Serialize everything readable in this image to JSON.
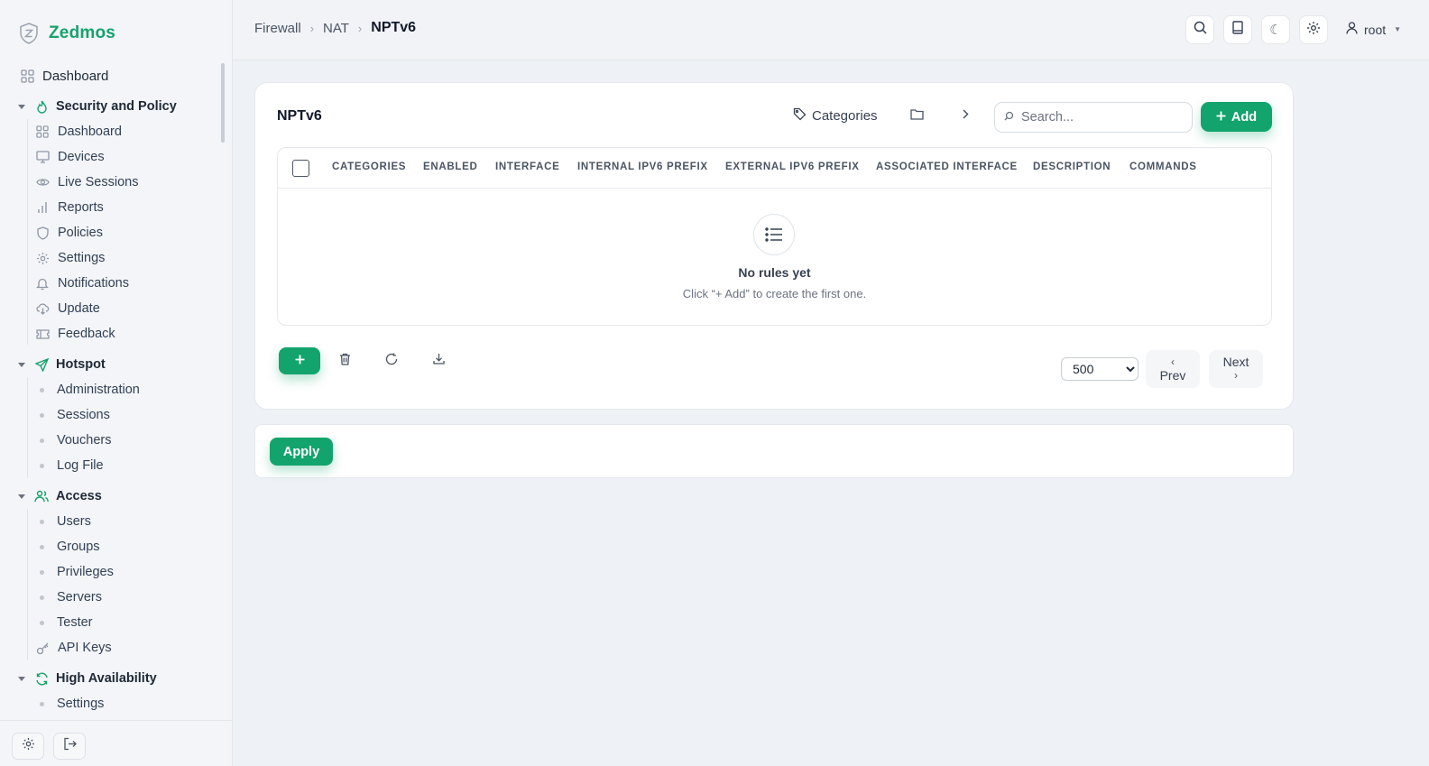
{
  "brand": {
    "name": "Zedmos",
    "logo_icon": "shield-z-icon",
    "accent": "#16a36b"
  },
  "sidebar": {
    "top_item": {
      "label": "Dashboard",
      "icon": "grid-icon"
    },
    "sections": [
      {
        "label": "Security and Policy",
        "icon": "flame-icon",
        "items": [
          {
            "label": "Dashboard",
            "icon": "grid-icon"
          },
          {
            "label": "Devices",
            "icon": "monitor-icon"
          },
          {
            "label": "Live Sessions",
            "icon": "eye-icon"
          },
          {
            "label": "Reports",
            "icon": "bar-chart-icon"
          },
          {
            "label": "Policies",
            "icon": "shield-icon"
          },
          {
            "label": "Settings",
            "icon": "gear-icon"
          },
          {
            "label": "Notifications",
            "icon": "bell-icon"
          },
          {
            "label": "Update",
            "icon": "cloud-download-icon"
          },
          {
            "label": "Feedback",
            "icon": "ticket-icon"
          }
        ]
      },
      {
        "label": "Hotspot",
        "icon": "send-icon",
        "items": [
          {
            "label": "Administration"
          },
          {
            "label": "Sessions"
          },
          {
            "label": "Vouchers"
          },
          {
            "label": "Log File"
          }
        ]
      },
      {
        "label": "Access",
        "icon": "users-icon",
        "items": [
          {
            "label": "Users"
          },
          {
            "label": "Groups"
          },
          {
            "label": "Privileges"
          },
          {
            "label": "Servers"
          },
          {
            "label": "Tester"
          },
          {
            "label": "API Keys",
            "icon": "key-icon"
          }
        ]
      },
      {
        "label": "High Availability",
        "icon": "refresh-icon",
        "items": [
          {
            "label": "Settings"
          }
        ]
      }
    ]
  },
  "breadcrumb": {
    "items": [
      "Firewall",
      "NAT"
    ],
    "current": "NPTv6"
  },
  "topbar": {
    "user": "root"
  },
  "card": {
    "title": "NPTv6",
    "categories_label": "Categories",
    "search_placeholder": "Search...",
    "add_label": "Add",
    "columns": [
      "CATEGORIES",
      "ENABLED",
      "INTERFACE",
      "INTERNAL IPV6 PREFIX",
      "EXTERNAL IPV6 PREFIX",
      "ASSOCIATED INTERFACE",
      "DESCRIPTION",
      "COMMANDS"
    ],
    "empty_title": "No rules yet",
    "empty_subtitle": "Click “+ Add” to create the first one.",
    "page_size": "500",
    "page_size_options": [
      "500"
    ],
    "prev_label": "Prev",
    "next_label": "Next"
  },
  "apply_label": "Apply"
}
